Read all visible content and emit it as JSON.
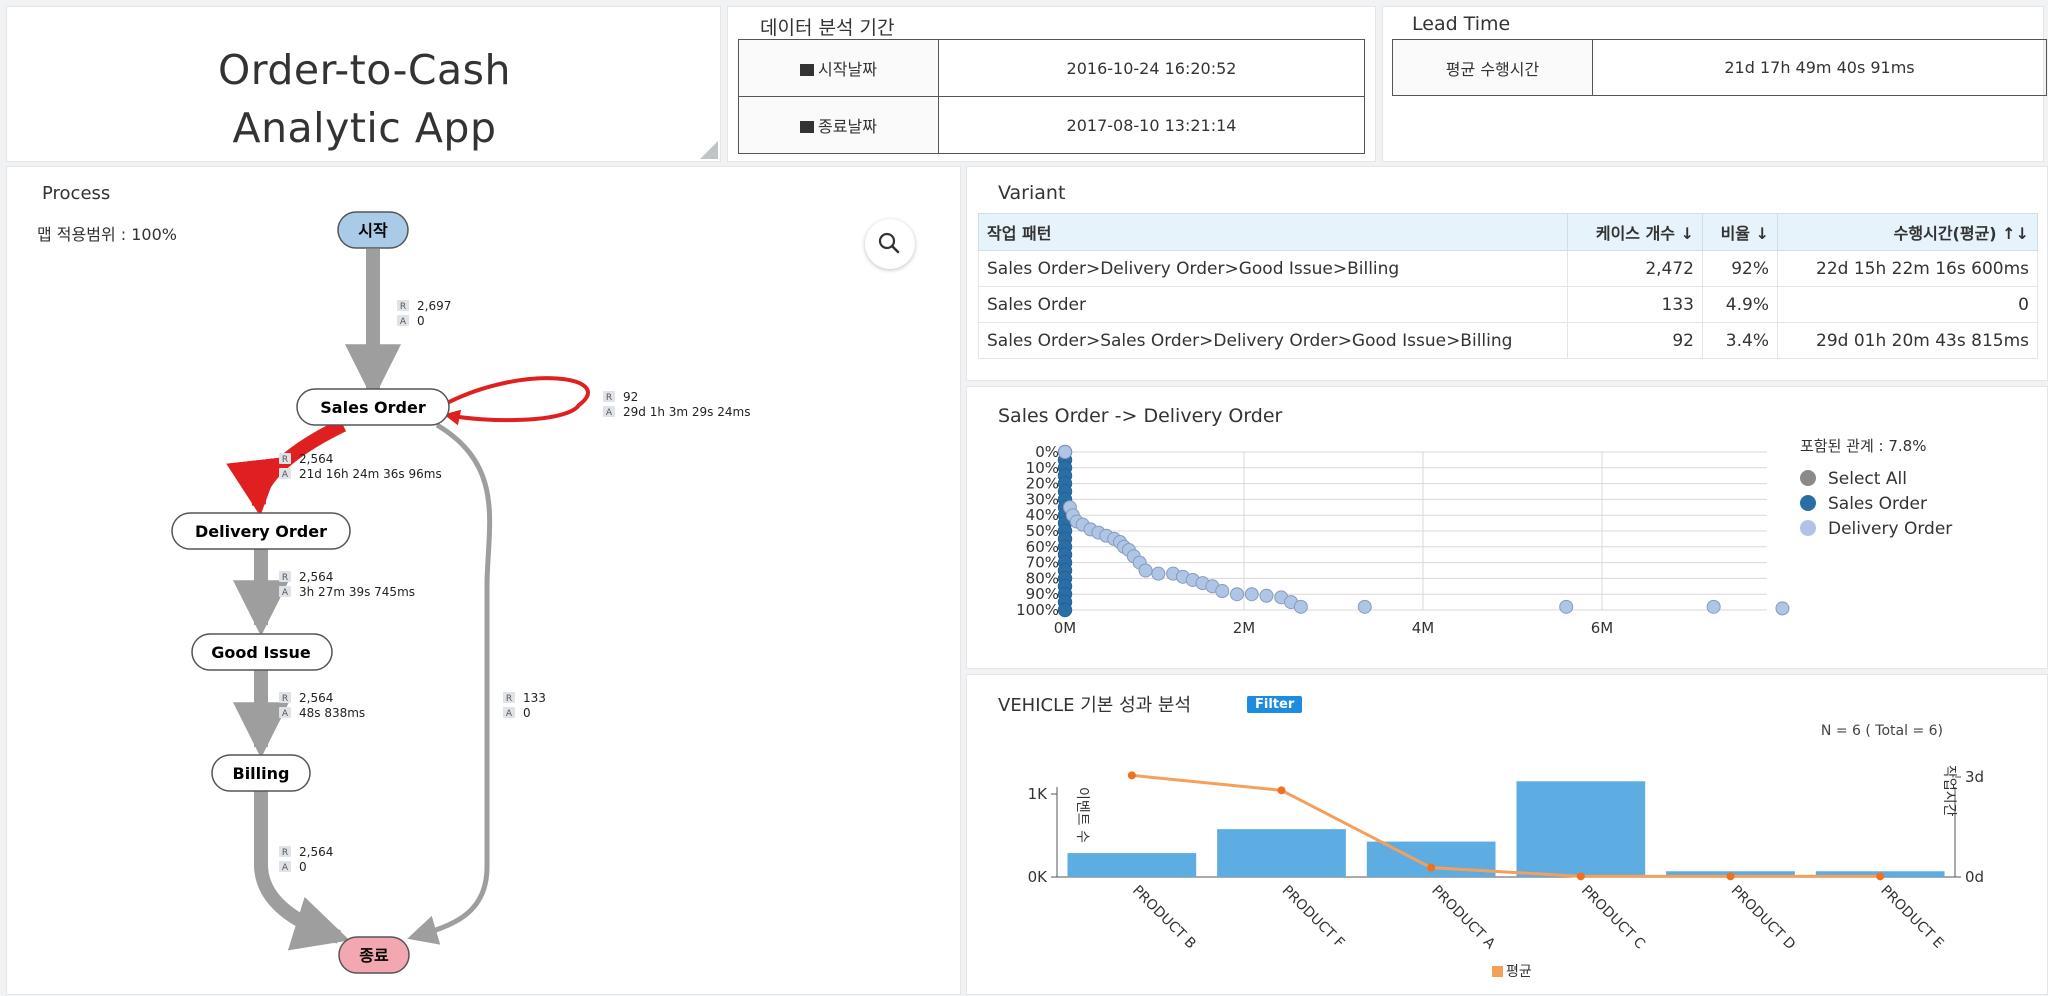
{
  "app": {
    "title_line1": "Order-to-Cash",
    "title_line2": "Analytic App"
  },
  "period": {
    "title": "데이터 분석 기간",
    "start_label": "시작날짜",
    "start_value": "2016-10-24 16:20:52",
    "end_label": "종료날짜",
    "end_value": "2017-08-10 13:21:14"
  },
  "lead_time": {
    "title": "Lead Time",
    "avg_label": "평균 수행시간",
    "avg_value": "21d 17h 49m 40s 91ms"
  },
  "process": {
    "title": "Process",
    "map_scope": "맵 적용범위 : 100%",
    "nodes": {
      "start": "시작",
      "sales_order": "Sales Order",
      "delivery_order": "Delivery Order",
      "good_issue": "Good Issue",
      "billing": "Billing",
      "end": "종료"
    },
    "edge_prefix_r": "R",
    "edge_prefix_a": "A",
    "edges": {
      "start_so": {
        "r": "2,697",
        "a": "0"
      },
      "so_loop": {
        "r": "92",
        "a": "29d 1h 3m 29s 24ms"
      },
      "so_do": {
        "r": "2,564",
        "a": "21d 16h 24m 36s 96ms"
      },
      "do_gi": {
        "r": "2,564",
        "a": "3h 27m 39s 745ms"
      },
      "gi_bill": {
        "r": "2,564",
        "a": "48s 838ms"
      },
      "so_end": {
        "r": "133",
        "a": "0"
      },
      "bill_end": {
        "r": "2,564",
        "a": "0"
      }
    },
    "colors": {
      "edge": "#9e9e9e",
      "hot_edge": "#e02020",
      "start_fill": "#a9cbe8",
      "end_fill": "#f3a7b0"
    }
  },
  "variant": {
    "title": "Variant",
    "headers": {
      "pattern": "작업 패턴",
      "cases": "케이스 개수 ↓",
      "ratio": "비율 ↓",
      "duration": "수행시간(평균) ↑↓"
    },
    "rows": [
      {
        "pattern": "Sales Order>Delivery Order>Good Issue>Billing",
        "cases": "2,472",
        "ratio": "92%",
        "duration": "22d 15h 22m 16s 600ms"
      },
      {
        "pattern": "Sales Order",
        "cases": "133",
        "ratio": "4.9%",
        "duration": "0"
      },
      {
        "pattern": "Sales Order>Sales Order>Delivery Order>Good Issue>Billing",
        "cases": "92",
        "ratio": "3.4%",
        "duration": "29d 01h 20m 43s 815ms"
      }
    ]
  },
  "scatter": {
    "title": "Sales Order -> Delivery Order",
    "included": "포함된 관계 : 7.8%",
    "legend": [
      "Select All",
      "Sales Order",
      "Delivery Order"
    ]
  },
  "vehicle": {
    "title": "VEHICLE 기본 성과 분석",
    "filter_label": "Filter",
    "n_label": "N = 6 ( Total = 6)",
    "left_axis_label": "이벤트 수",
    "right_axis_label": "작업시간",
    "legend_label": "평균"
  },
  "chart_data": [
    {
      "type": "scatter",
      "title": "Sales Order -> Delivery Order",
      "x_ticks": [
        "0M",
        "2M",
        "4M",
        "6M"
      ],
      "y_ticks": [
        "0%",
        "10%",
        "20%",
        "30%",
        "40%",
        "50%",
        "60%",
        "70%",
        "80%",
        "90%",
        "100%"
      ],
      "xlim": [
        0,
        8000000
      ],
      "ylim": [
        0,
        100
      ],
      "y_inverted": true,
      "grid": true,
      "legend_position": "right",
      "colors": {
        "select_all": "#8a8a8a",
        "sales_order": "#2a6ea6",
        "delivery_order": "#aec5e6"
      },
      "series": [
        {
          "name": "Sales Order",
          "x": [
            0,
            0,
            0,
            0,
            0,
            0,
            0,
            0,
            0,
            0,
            0,
            0,
            0,
            0,
            0,
            0,
            0,
            0,
            0,
            0,
            0
          ],
          "y": [
            0,
            5,
            10,
            15,
            20,
            25,
            30,
            35,
            40,
            45,
            50,
            55,
            60,
            65,
            70,
            75,
            80,
            85,
            90,
            95,
            100
          ]
        },
        {
          "name": "Delivery Order",
          "x": [
            0,
            50000,
            80000,
            120000,
            180000,
            260000,
            340000,
            420000,
            500000,
            560000,
            600000,
            650000,
            700000,
            760000,
            820000,
            950000,
            1100000,
            1200000,
            1300000,
            1400000,
            1500000,
            1600000,
            1750000,
            1900000,
            2050000,
            2200000,
            2300000,
            2400000,
            3050000,
            5100000,
            6600000,
            7300000
          ],
          "y": [
            0,
            35,
            40,
            44,
            46,
            49,
            51,
            53,
            55,
            57,
            60,
            62,
            66,
            70,
            75,
            77,
            77,
            79,
            81,
            83,
            85,
            88,
            90,
            90,
            91,
            92,
            95,
            98,
            98,
            98,
            98,
            99
          ]
        }
      ]
    },
    {
      "type": "bar",
      "title": "VEHICLE 기본 성과 분석",
      "categories": [
        "PRODUCT B",
        "PRODUCT F",
        "PRODUCT A",
        "PRODUCT C",
        "PRODUCT D",
        "PRODUCT E"
      ],
      "y_left_ticks": [
        "0K",
        "1K"
      ],
      "y_right_ticks": [
        "0d",
        "3d"
      ],
      "ylim_left": [
        0,
        1300
      ],
      "ylim_right": [
        0,
        3
      ],
      "bar_color": "#5dade2",
      "line_color": "#f5a05a",
      "series": [
        {
          "name": "",
          "axis": "left",
          "values": [
            250,
            500,
            370,
            1000,
            60,
            60
          ]
        },
        {
          "name": "평균",
          "axis": "right",
          "type": "line",
          "values": [
            3.05,
            2.6,
            0.28,
            0.02,
            0.02,
            0.02
          ]
        }
      ]
    }
  ]
}
